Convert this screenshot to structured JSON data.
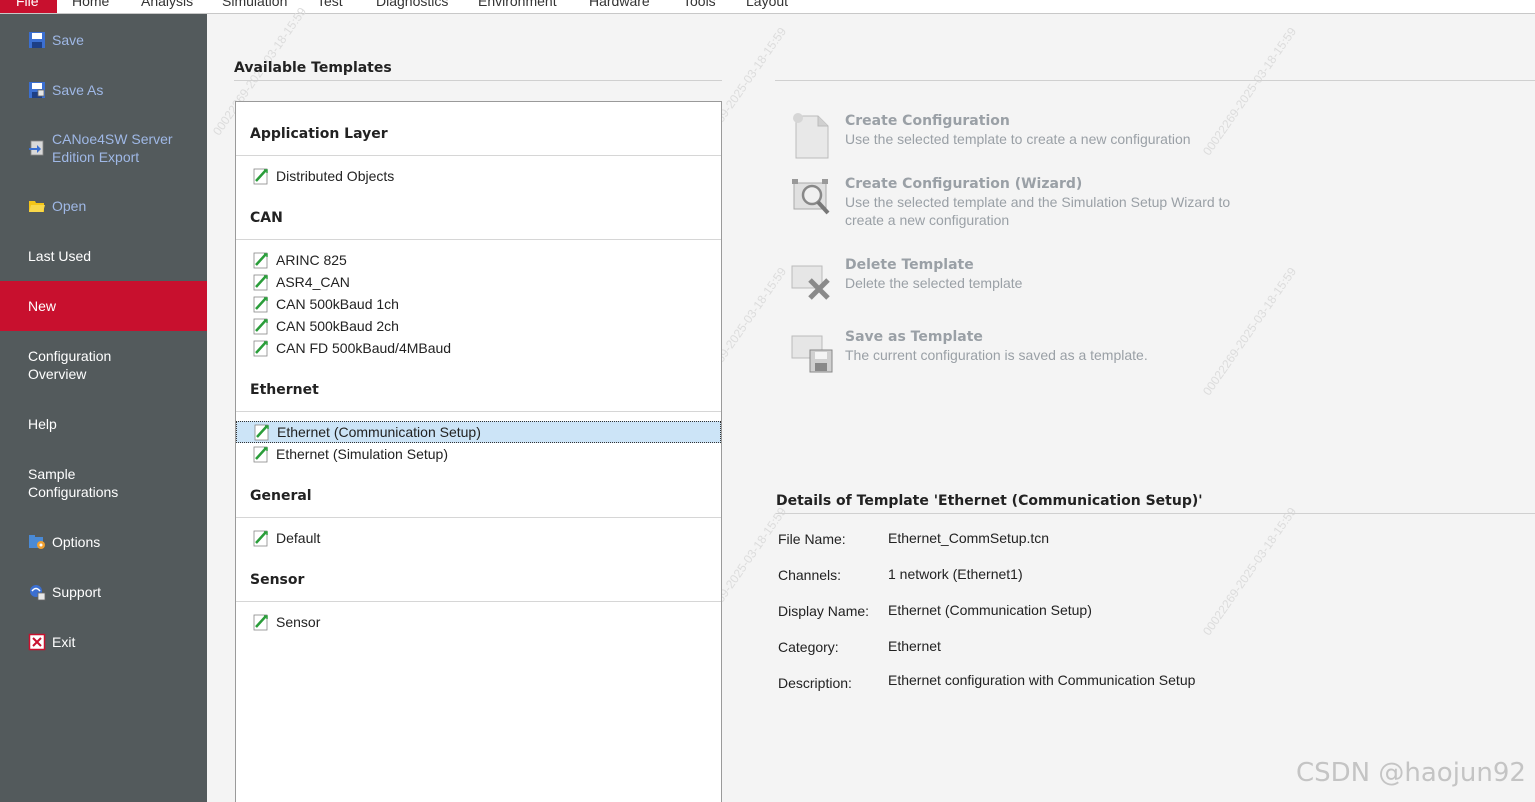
{
  "menubar": {
    "tabs": [
      "File",
      "Home",
      "Analysis",
      "Simulation",
      "Test",
      "Diagnostics",
      "Environment",
      "Hardware",
      "Tools",
      "Layout"
    ]
  },
  "sidebar": {
    "items": [
      {
        "label": "Save",
        "icon": "floppy-disk-icon",
        "enabled": false
      },
      {
        "label": "Save As",
        "icon": "floppy-save-as-icon",
        "enabled": false
      },
      {
        "label": "CANoe4SW Server\nEdition Export",
        "icon": "export-icon",
        "enabled": false
      },
      {
        "label": "Open",
        "icon": "folder-open-icon",
        "enabled": false
      },
      {
        "label": "Last Used",
        "icon": "",
        "enabled": true
      },
      {
        "label": "New",
        "icon": "",
        "enabled": true,
        "active": true
      },
      {
        "label": "Configuration\nOverview",
        "icon": "",
        "enabled": true
      },
      {
        "label": "Help",
        "icon": "",
        "enabled": true
      },
      {
        "label": "Sample\nConfigurations",
        "icon": "",
        "enabled": true
      },
      {
        "label": "Options",
        "icon": "options-icon",
        "enabled": true
      },
      {
        "label": "Support",
        "icon": "support-icon",
        "enabled": true
      },
      {
        "label": "Exit",
        "icon": "exit-icon",
        "enabled": true
      }
    ]
  },
  "templates": {
    "title": "Available Templates",
    "groups": [
      {
        "name": "Application Layer",
        "items": [
          "Distributed Objects"
        ]
      },
      {
        "name": "CAN",
        "items": [
          "ARINC 825",
          "ASR4_CAN",
          "CAN 500kBaud 1ch",
          "CAN 500kBaud 2ch",
          "CAN FD 500kBaud/4MBaud"
        ]
      },
      {
        "name": "Ethernet",
        "items": [
          "Ethernet (Communication Setup)",
          "Ethernet (Simulation Setup)"
        ]
      },
      {
        "name": "General",
        "items": [
          "Default"
        ]
      },
      {
        "name": "Sensor",
        "items": [
          "Sensor"
        ]
      }
    ],
    "selected": "Ethernet (Communication Setup)"
  },
  "actions": [
    {
      "title": "Create Configuration",
      "desc": "Use the selected template to create a new configuration",
      "icon": "new-document-icon"
    },
    {
      "title": "Create Configuration (Wizard)",
      "desc": "Use the selected template and the Simulation Setup Wizard to create a new configuration",
      "icon": "wizard-magnifier-icon"
    },
    {
      "title": "Delete Template",
      "desc": "Delete the selected template",
      "icon": "delete-template-icon"
    },
    {
      "title": "Save as Template",
      "desc": "The current configuration is saved as a template.",
      "icon": "save-template-icon"
    }
  ],
  "details": {
    "title": "Details of Template 'Ethernet (Communication Setup)'",
    "rows": [
      {
        "label": "File Name:",
        "value": "Ethernet_CommSetup.tcn"
      },
      {
        "label": "Channels:",
        "value": "1 network (Ethernet1)"
      },
      {
        "label": "Display Name:",
        "value": "Ethernet (Communication Setup)"
      },
      {
        "label": "Category:",
        "value": "Ethernet"
      },
      {
        "label": "Description:",
        "value": "Ethernet configuration with Communication Setup"
      }
    ]
  },
  "watermark": "CSDN @haojun92",
  "colors": {
    "accent": "#c8102e",
    "sidebar": "#535a5c",
    "selection": "#cce4f7",
    "disabled": "#9aa0a6"
  }
}
